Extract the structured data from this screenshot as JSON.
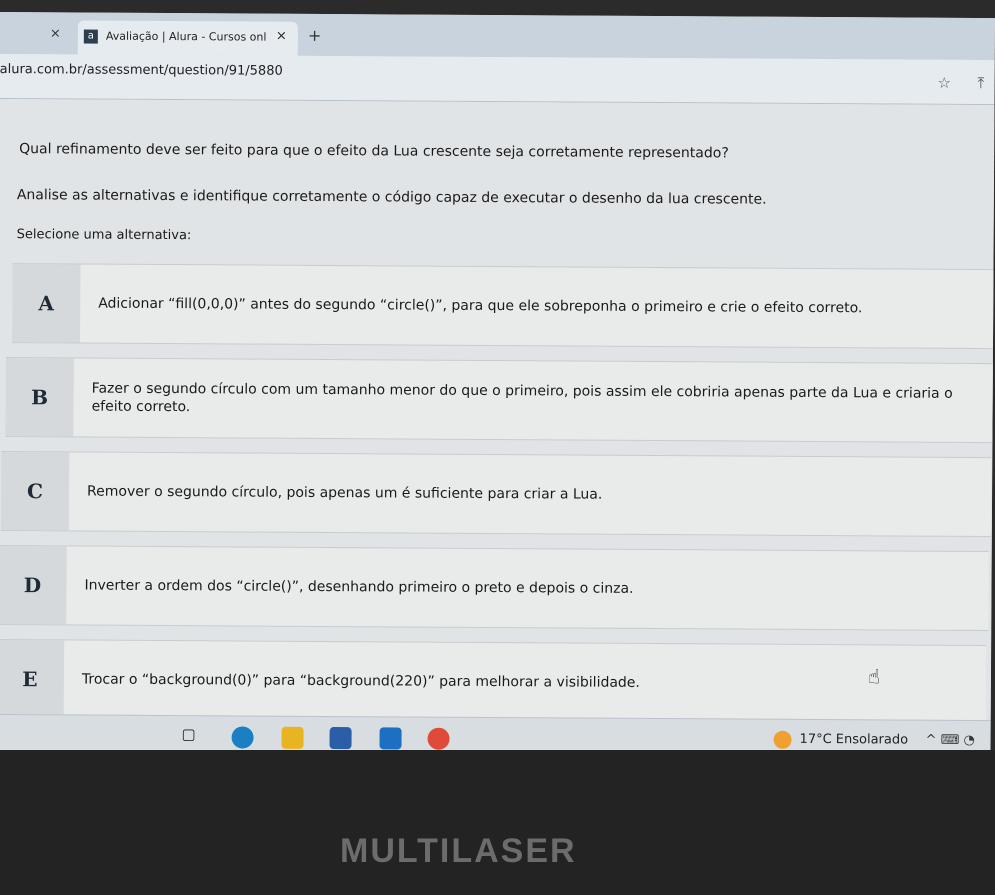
{
  "browser": {
    "prev_tab_close": "×",
    "tab": {
      "favicon": "a",
      "title": "Avaliação | Alura - Cursos online",
      "close": "×"
    },
    "new_tab": "+",
    "url": "alura.com.br/assessment/question/91/5880",
    "star_icon": "☆",
    "extension_icon": "⤒"
  },
  "page": {
    "question": "Qual refinamento deve ser feito para que o efeito da Lua crescente seja corretamente representado?",
    "instruction": "Analise as alternativas e identifique corretamente o código capaz de executar o desenho da lua crescente.",
    "select_label": "Selecione uma alternativa:",
    "options": [
      {
        "letter": "A",
        "text": "Adicionar “fill(0,0,0)” antes do segundo “circle()”, para que ele sobreponha o primeiro e crie o efeito correto."
      },
      {
        "letter": "B",
        "text": "Fazer o segundo círculo com um tamanho menor do que o primeiro, pois assim ele cobriria apenas parte da Lua e criaria o efeito correto."
      },
      {
        "letter": "C",
        "text": "Remover o segundo círculo, pois apenas um é suficiente para criar a Lua."
      },
      {
        "letter": "D",
        "text": "Inverter a ordem dos “circle()”, desenhando primeiro o preto e depois o cinza."
      },
      {
        "letter": "E",
        "text": "Trocar o “background(0)” para “background(220)” para melhorar a visibilidade."
      }
    ]
  },
  "taskbar": {
    "task_view_icon": "▢",
    "weather": "17°C  Ensolarado",
    "tray": "^  ⌨  ◔"
  },
  "bezel": {
    "brand": "MULTILASER"
  },
  "colors": {
    "letter_text": "#1e2a36",
    "weather_icon": "#f0a030"
  }
}
